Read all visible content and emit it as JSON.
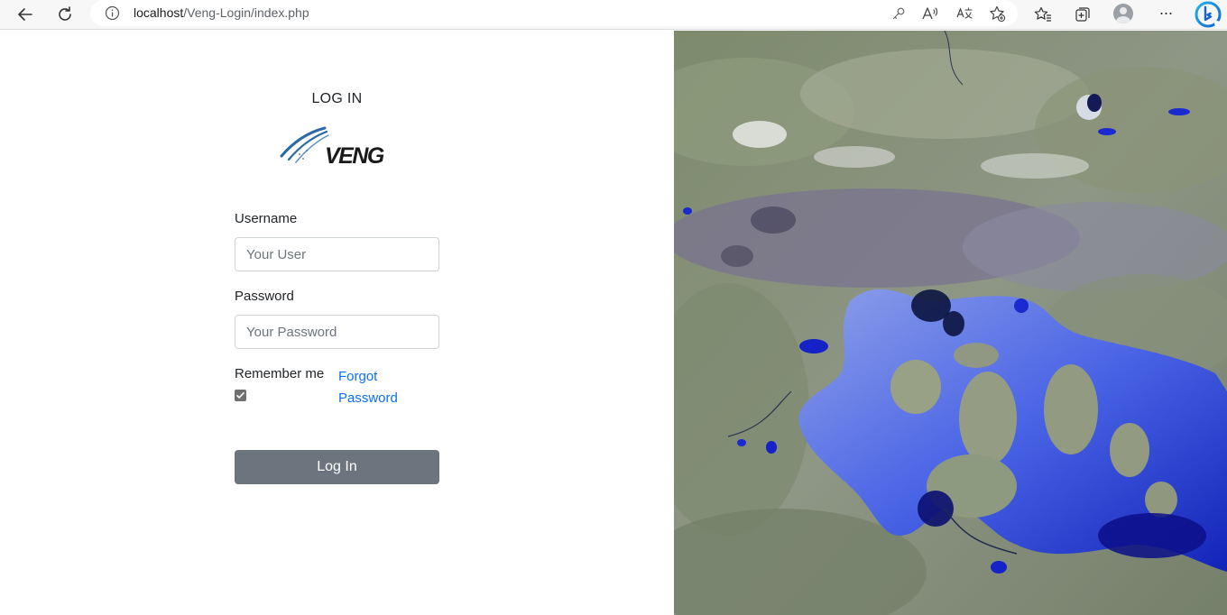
{
  "browser": {
    "url_host": "localhost",
    "url_path": "/Veng-Login/index.php",
    "icons": [
      "back-icon",
      "refresh-icon",
      "info-icon",
      "key-icon",
      "read-aloud-icon",
      "translate-icon",
      "add-favorite-icon",
      "favorites-icon",
      "collections-icon",
      "profile-icon",
      "more-icon",
      "bing-icon"
    ]
  },
  "login": {
    "title": "LOG IN",
    "logo_text": "VENG",
    "username_label": "Username",
    "username_placeholder": "Your User",
    "password_label": "Password",
    "password_placeholder": "Your Password",
    "remember_label": "Remember me",
    "remember_checked": true,
    "forgot_line1": "Forgot",
    "forgot_line2": "Password",
    "submit_label": "Log In"
  },
  "colors": {
    "primary_link": "#0d6efd",
    "button": "#6c757d"
  }
}
